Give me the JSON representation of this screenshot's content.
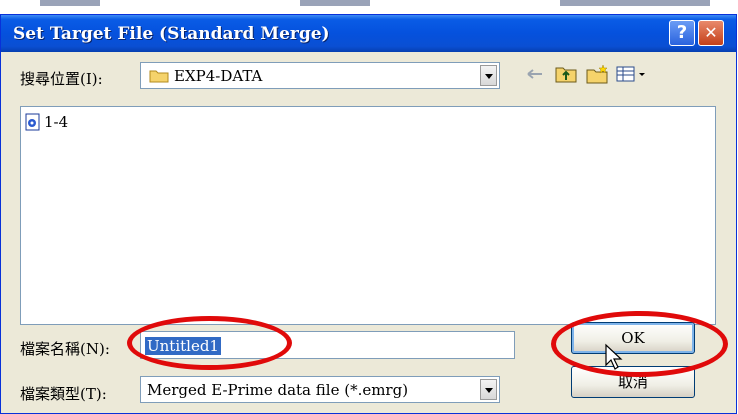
{
  "window": {
    "title": "Set Target File (Standard Merge)",
    "help_label": "?",
    "close_label": "✕"
  },
  "lookin": {
    "label": "搜尋位置(I):",
    "value": "EXP4-DATA"
  },
  "toolbar": {
    "icons": [
      "back-arrow-icon",
      "up-folder-icon",
      "new-folder-icon",
      "view-menu-icon"
    ]
  },
  "files": [
    {
      "name": "1-4",
      "icon": "emrg-file-icon"
    }
  ],
  "filename": {
    "label": "檔案名稱(N):",
    "value": "Untitled1"
  },
  "filetype": {
    "label": "檔案類型(T):",
    "value": "Merged E-Prime data file (*.emrg)"
  },
  "buttons": {
    "ok": "OK",
    "cancel": "取消"
  },
  "colors": {
    "titlebar": "#0551dd",
    "annotation": "#e00a0a",
    "selection": "#316ac5"
  }
}
